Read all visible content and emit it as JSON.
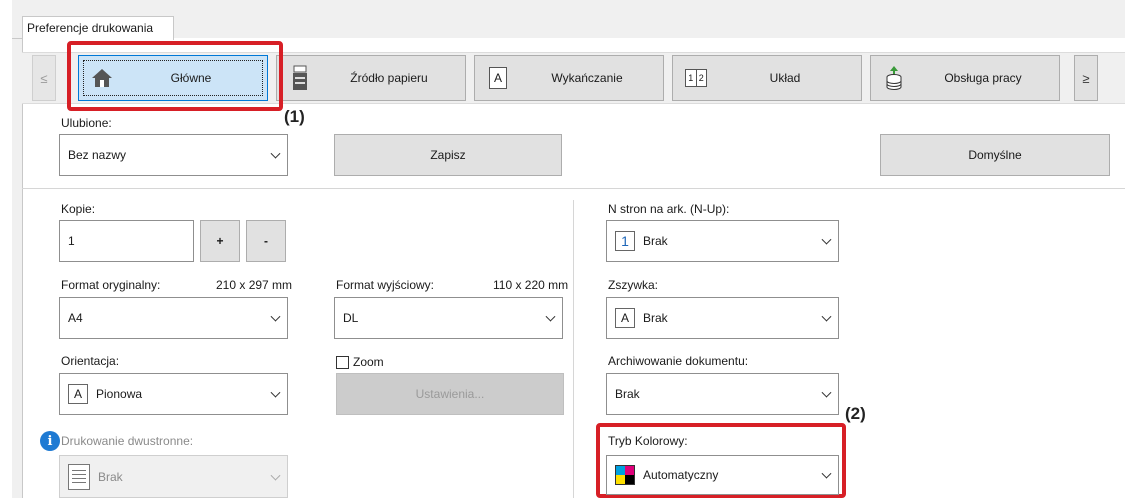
{
  "window": {
    "tab_title": "Preferencje drukowania"
  },
  "nav": {
    "prev": "≤",
    "next": "≥",
    "tabs": [
      {
        "label": "Główne",
        "icon": "home-icon"
      },
      {
        "label": "Źródło papieru",
        "icon": "paper-tray-icon"
      },
      {
        "label": "Wykańczanie",
        "icon": "finishing-icon"
      },
      {
        "label": "Układ",
        "icon": "layout-icon"
      },
      {
        "label": "Obsługa pracy",
        "icon": "job-handling-icon"
      }
    ]
  },
  "favorites": {
    "label": "Ulubione:",
    "value": "Bez nazwy",
    "save_label": "Zapisz",
    "default_label": "Domyślne"
  },
  "copies": {
    "label": "Kopie:",
    "value": "1",
    "plus": "+",
    "minus": "-"
  },
  "original_size": {
    "label": "Format oryginalny:",
    "size": "210 x 297 mm",
    "value": "A4"
  },
  "output_size": {
    "label": "Format wyjściowy:",
    "size": "110 x 220 mm",
    "value": "DL"
  },
  "orientation": {
    "label": "Orientacja:",
    "value": "Pionowa",
    "icon_letter": "A"
  },
  "zoom": {
    "label": "Zoom",
    "settings_label": "Ustawienia..."
  },
  "duplex": {
    "label": "Drukowanie dwustronne:",
    "value": "Brak"
  },
  "nup": {
    "label": "N stron na ark. (N-Up):",
    "value": "Brak",
    "icon_text": "1"
  },
  "staple": {
    "label": "Zszywka:",
    "value": "Brak",
    "icon_letter": "A"
  },
  "archive": {
    "label": "Archiwowanie dokumentu:",
    "value": "Brak"
  },
  "color_mode": {
    "label": "Tryb Kolorowy:",
    "value": "Automatyczny"
  },
  "callouts": {
    "one": "(1)",
    "two": "(2)"
  },
  "colors": {
    "highlight": "#d71f26",
    "active_tab": "#cce4f7",
    "info": "#1e7ad3"
  }
}
